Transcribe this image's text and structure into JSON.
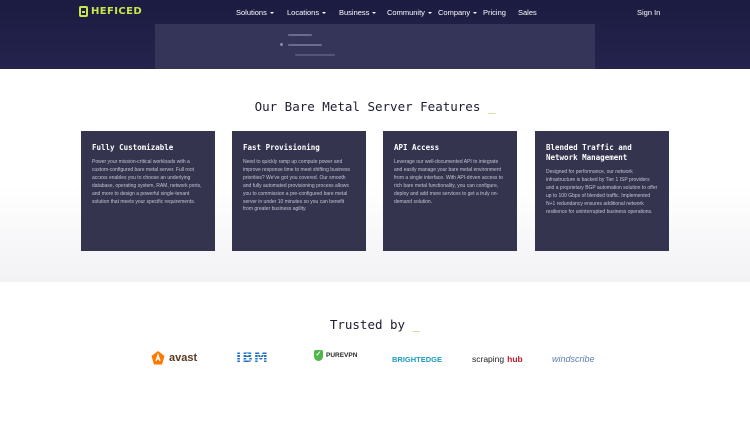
{
  "brand": {
    "logo_text": "HEFICED",
    "accent_color": "#c6e84a"
  },
  "nav": {
    "items": [
      {
        "label": "Solutions",
        "has_dropdown": true
      },
      {
        "label": "Locations",
        "has_dropdown": true
      },
      {
        "label": "Business",
        "has_dropdown": true
      },
      {
        "label": "Community",
        "has_dropdown": true
      },
      {
        "label": "Company",
        "has_dropdown": true
      },
      {
        "label": "Pricing",
        "has_dropdown": false
      },
      {
        "label": "Sales",
        "has_dropdown": false
      }
    ],
    "sign_in": "Sign In"
  },
  "features": {
    "title": "Our Bare Metal Server Features",
    "cursor": "_",
    "cards": [
      {
        "title": "Fully Customizable",
        "text": "Power your mission-critical workloads with a custom-configured bare metal server. Full root access enables you to choose an underlying database, operating system, RAM, network ports, and more to design a powerful single-tenant solution that meets your specific requirements."
      },
      {
        "title": "Fast Provisioning",
        "text": "Need to quickly ramp up compute power and improve response time to meet shifting business priorities? We've got you covered. Our smooth and fully automated provisioning process allows you to commission a pre-configured bare metal server in under 10 minutes so you can benefit from greater business agility."
      },
      {
        "title": "API Access",
        "text": "Leverage our well-documented API to integrate and easily manage your bare metal environment from a single interface. With API-driven access to rich bare metal functionality, you can configure, deploy and add more services to get a truly on-demand solution."
      },
      {
        "title": "Blended Traffic and Network Management",
        "text": "Designed for performance, our network infrastructure is backed by Tier 1 ISP providers and a proprietary BGP automation solution to offer up to 100 Gbps of blended traffic. Implemented N+1 redundancy ensures additional network resilience for uninterrupted business operations."
      }
    ]
  },
  "trusted": {
    "title": "Trusted by",
    "cursor": "_",
    "logos": [
      {
        "name": "avast"
      },
      {
        "name": "IBM"
      },
      {
        "name": "PUREVPN"
      },
      {
        "name": "BRIGHTEDGE"
      },
      {
        "name_part1": "scraping",
        "name_part2": "hub"
      },
      {
        "name": "windscribe"
      }
    ]
  }
}
